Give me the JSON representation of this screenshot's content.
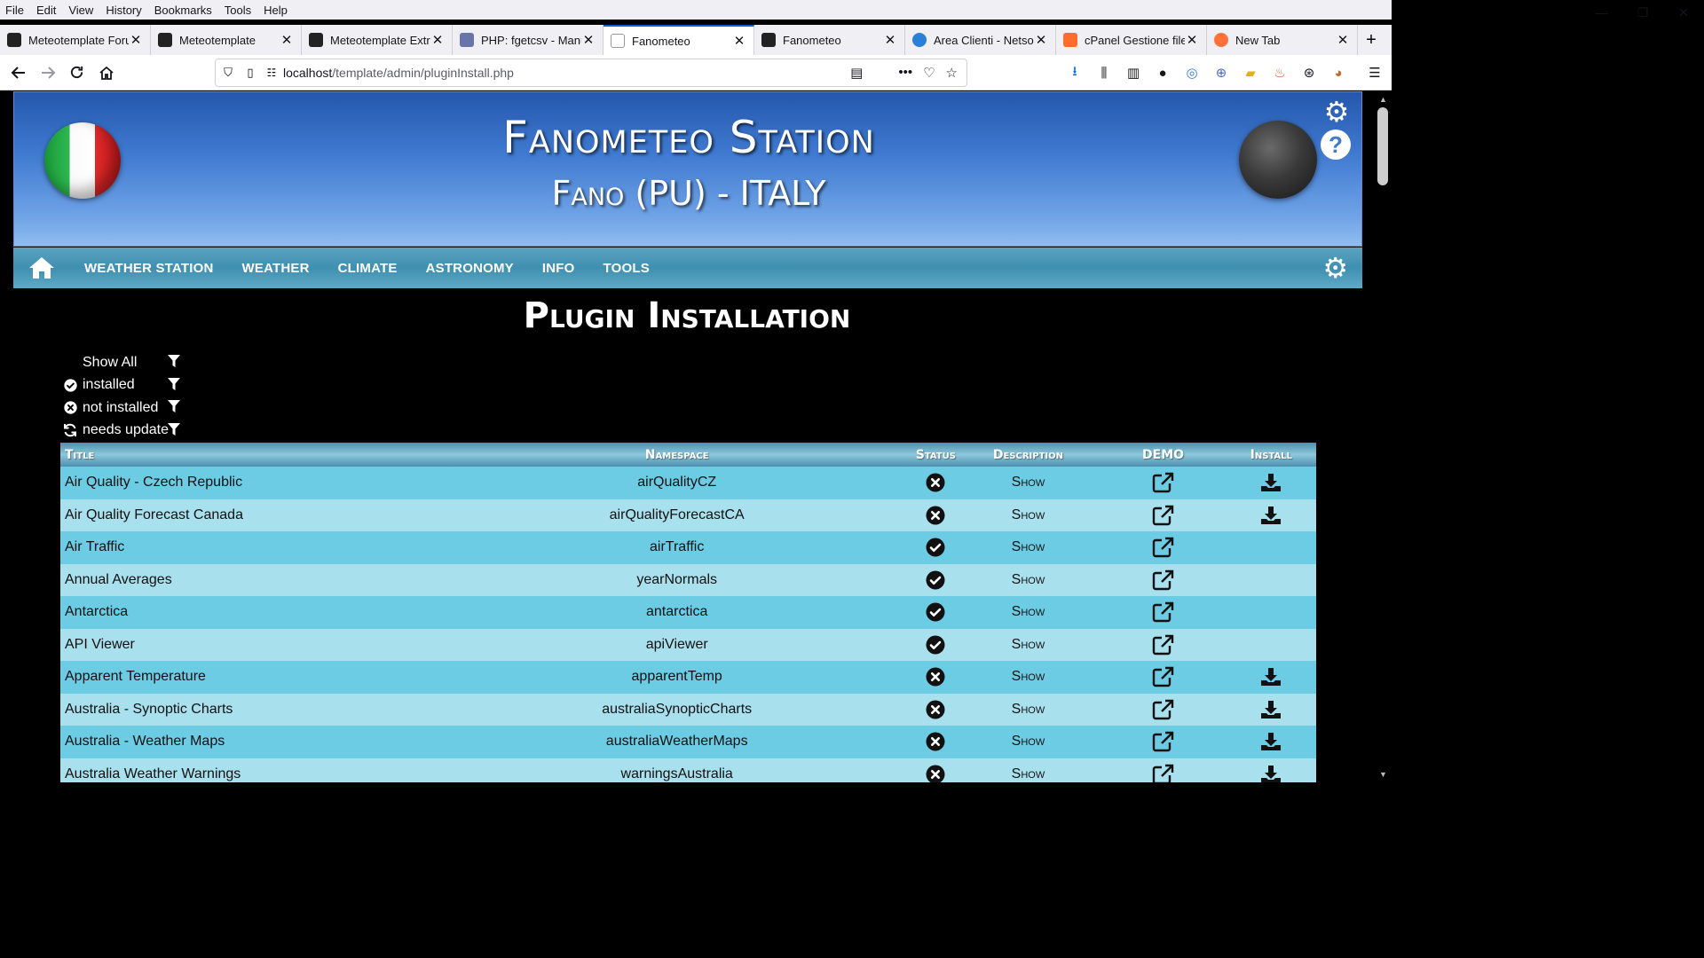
{
  "menubar": [
    "File",
    "Edit",
    "View",
    "History",
    "Bookmarks",
    "Tools",
    "Help"
  ],
  "window_controls": [
    "—",
    "❐",
    "✕"
  ],
  "tabs": [
    {
      "label": "Meteotemplate Forum -",
      "icon": "meteotemplate-icon",
      "active": false
    },
    {
      "label": "Meteotemplate",
      "icon": "meteotemplate-icon",
      "active": false
    },
    {
      "label": "Meteotemplate Extr",
      "icon": "meteotemplate-icon",
      "active": false
    },
    {
      "label": "PHP: fgetcsv - Manu",
      "icon": "php-icon",
      "active": false
    },
    {
      "label": "Fanometeo",
      "icon": "fanometeo-icon",
      "active": true
    },
    {
      "label": "Fanometeo",
      "icon": "meteotemplate-icon",
      "active": false
    },
    {
      "label": "Area Clienti - Netso",
      "icon": "netsons-icon",
      "active": false
    },
    {
      "label": "cPanel Gestione file",
      "icon": "cpanel-icon",
      "active": false
    },
    {
      "label": "New Tab",
      "icon": "firefox-icon",
      "active": false
    }
  ],
  "url": {
    "host": "localhost",
    "path": "/template/admin/pluginInstall.php"
  },
  "header": {
    "title": "Fanometeo Station",
    "subtitle": "Fano (PU) - ITALY"
  },
  "mainnav": [
    "WEATHER STATION",
    "WEATHER",
    "CLIMATE",
    "ASTRONOMY",
    "INFO",
    "TOOLS"
  ],
  "page_title": "Plugin Installation",
  "filters": [
    {
      "label": "Show All",
      "icon": ""
    },
    {
      "label": "installed",
      "icon": "check-circle-icon"
    },
    {
      "label": "not installed",
      "icon": "x-circle-icon"
    },
    {
      "label": "needs update",
      "icon": "refresh-icon"
    }
  ],
  "table": {
    "columns": [
      "Title",
      "Namespace",
      "Status",
      "Description",
      "DEMO",
      "Install"
    ],
    "rows": [
      {
        "title": "Air Quality - Czech Republic",
        "namespace": "airQualityCZ",
        "status": "not installed",
        "description": "Show",
        "install": true
      },
      {
        "title": "Air Quality Forecast Canada",
        "namespace": "airQualityForecastCA",
        "status": "not installed",
        "description": "Show",
        "install": true
      },
      {
        "title": "Air Traffic",
        "namespace": "airTraffic",
        "status": "installed",
        "description": "Show",
        "install": false
      },
      {
        "title": "Annual Averages",
        "namespace": "yearNormals",
        "status": "installed",
        "description": "Show",
        "install": false
      },
      {
        "title": "Antarctica",
        "namespace": "antarctica",
        "status": "installed",
        "description": "Show",
        "install": false
      },
      {
        "title": "API Viewer",
        "namespace": "apiViewer",
        "status": "installed",
        "description": "Show",
        "install": false
      },
      {
        "title": "Apparent Temperature",
        "namespace": "apparentTemp",
        "status": "not installed",
        "description": "Show",
        "install": true
      },
      {
        "title": "Australia - Synoptic Charts",
        "namespace": "australiaSynopticCharts",
        "status": "not installed",
        "description": "Show",
        "install": true
      },
      {
        "title": "Australia - Weather Maps",
        "namespace": "australiaWeatherMaps",
        "status": "not installed",
        "description": "Show",
        "install": true
      },
      {
        "title": "Australia Weather Warnings",
        "namespace": "warningsAustralia",
        "status": "not installed",
        "description": "Show",
        "install": true
      }
    ]
  },
  "colors": {
    "row_odd": "#6ccce4",
    "row_even": "#a8e0ee",
    "header_blue": "#3f7ad0",
    "nav_teal": "#3f8fb0"
  }
}
